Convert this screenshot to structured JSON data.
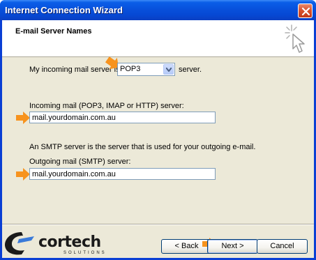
{
  "window": {
    "title": "Internet Connection Wizard"
  },
  "header": {
    "title": "E-mail Server Names"
  },
  "incoming_type": {
    "label_prefix": "My incoming mail server is a",
    "selected": "POP3",
    "label_suffix": "server."
  },
  "incoming_server": {
    "label": "Incoming mail (POP3, IMAP or HTTP) server:",
    "value": "mail.yourdomain.com.au"
  },
  "smtp_note": "An SMTP server is the server that is used for your outgoing e-mail.",
  "outgoing_server": {
    "label": "Outgoing mail (SMTP) server:",
    "value": "mail.yourdomain.com.au"
  },
  "buttons": {
    "back": "< Back",
    "next": "Next >",
    "cancel": "Cancel"
  },
  "branding": {
    "logo_text": "cortech",
    "logo_sub": "SOLUTIONS"
  },
  "colors": {
    "title_bar": "#0a5ee8",
    "client_bg": "#ece9d8",
    "annotation_arrow": "#f7931e",
    "field_border": "#7f9db9"
  },
  "icons": [
    "close-icon",
    "wizard-sparkle-icon",
    "dropdown-arrow-icon",
    "orange-arrow-icon",
    "cortech-logo-icon"
  ]
}
